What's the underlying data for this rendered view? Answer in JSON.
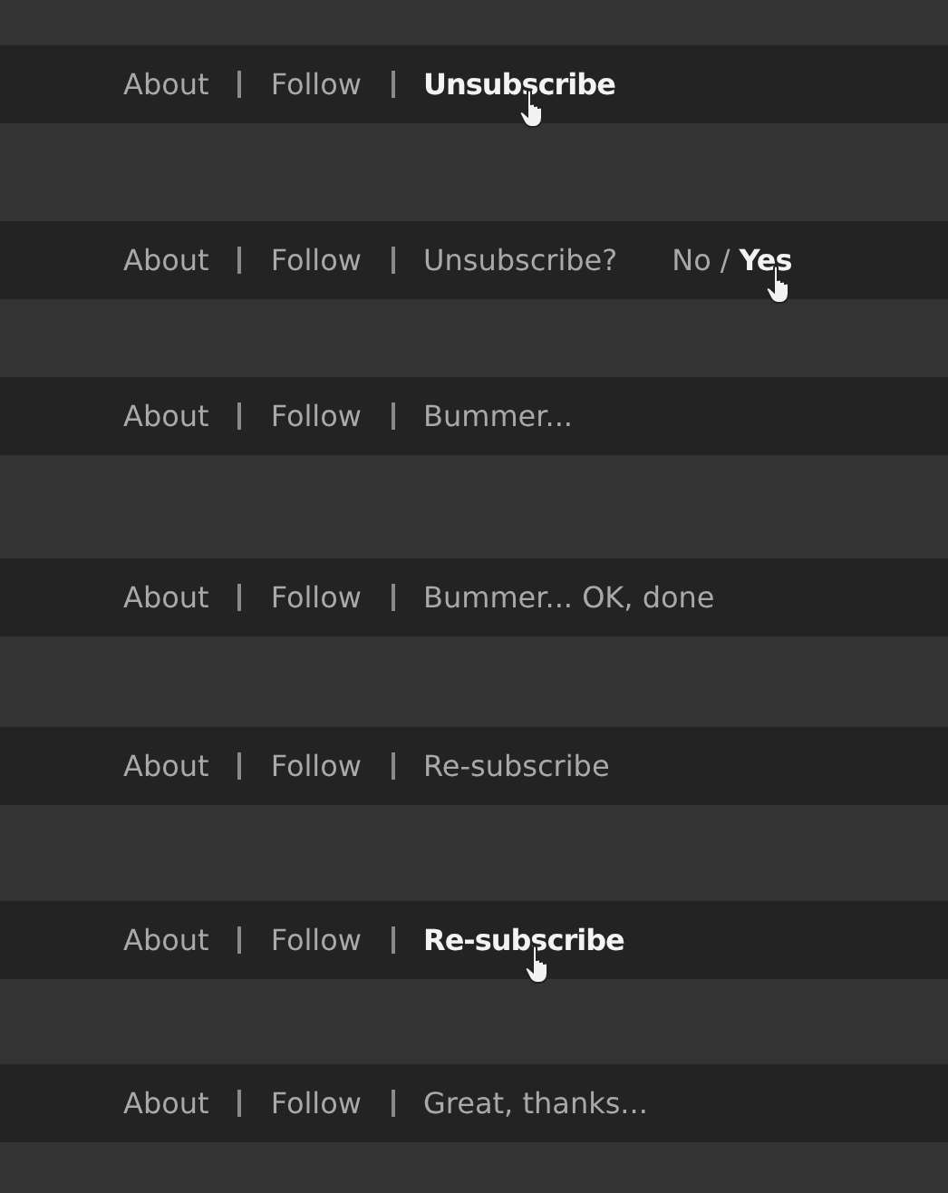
{
  "rows": [
    {
      "items": [
        {
          "label": "About",
          "hovered": false
        },
        {
          "label": "Follow",
          "hovered": false
        },
        {
          "label": "Unsubscribe",
          "hovered": true
        }
      ]
    },
    {
      "items": [
        {
          "label": "About",
          "hovered": false
        },
        {
          "label": "Follow",
          "hovered": false
        },
        {
          "label": "Unsubscribe?",
          "hovered": false
        }
      ],
      "confirm": {
        "options": [
          {
            "label": "No",
            "hovered": false
          },
          {
            "label": "Yes",
            "hovered": true
          }
        ],
        "separator": "/"
      }
    },
    {
      "items": [
        {
          "label": "About",
          "hovered": false
        },
        {
          "label": "Follow",
          "hovered": false
        },
        {
          "label": "Bummer...",
          "hovered": false
        }
      ]
    },
    {
      "items": [
        {
          "label": "About",
          "hovered": false
        },
        {
          "label": "Follow",
          "hovered": false
        },
        {
          "label": "Bummer... OK, done",
          "hovered": false
        }
      ]
    },
    {
      "items": [
        {
          "label": "About",
          "hovered": false
        },
        {
          "label": "Follow",
          "hovered": false
        },
        {
          "label": "Re-subscribe",
          "hovered": false
        }
      ]
    },
    {
      "items": [
        {
          "label": "About",
          "hovered": false
        },
        {
          "label": "Follow",
          "hovered": false
        },
        {
          "label": "Re-subscribe",
          "hovered": true
        }
      ]
    },
    {
      "items": [
        {
          "label": "About",
          "hovered": false
        },
        {
          "label": "Follow",
          "hovered": false
        },
        {
          "label": "Great, thanks...",
          "hovered": false
        }
      ]
    }
  ]
}
